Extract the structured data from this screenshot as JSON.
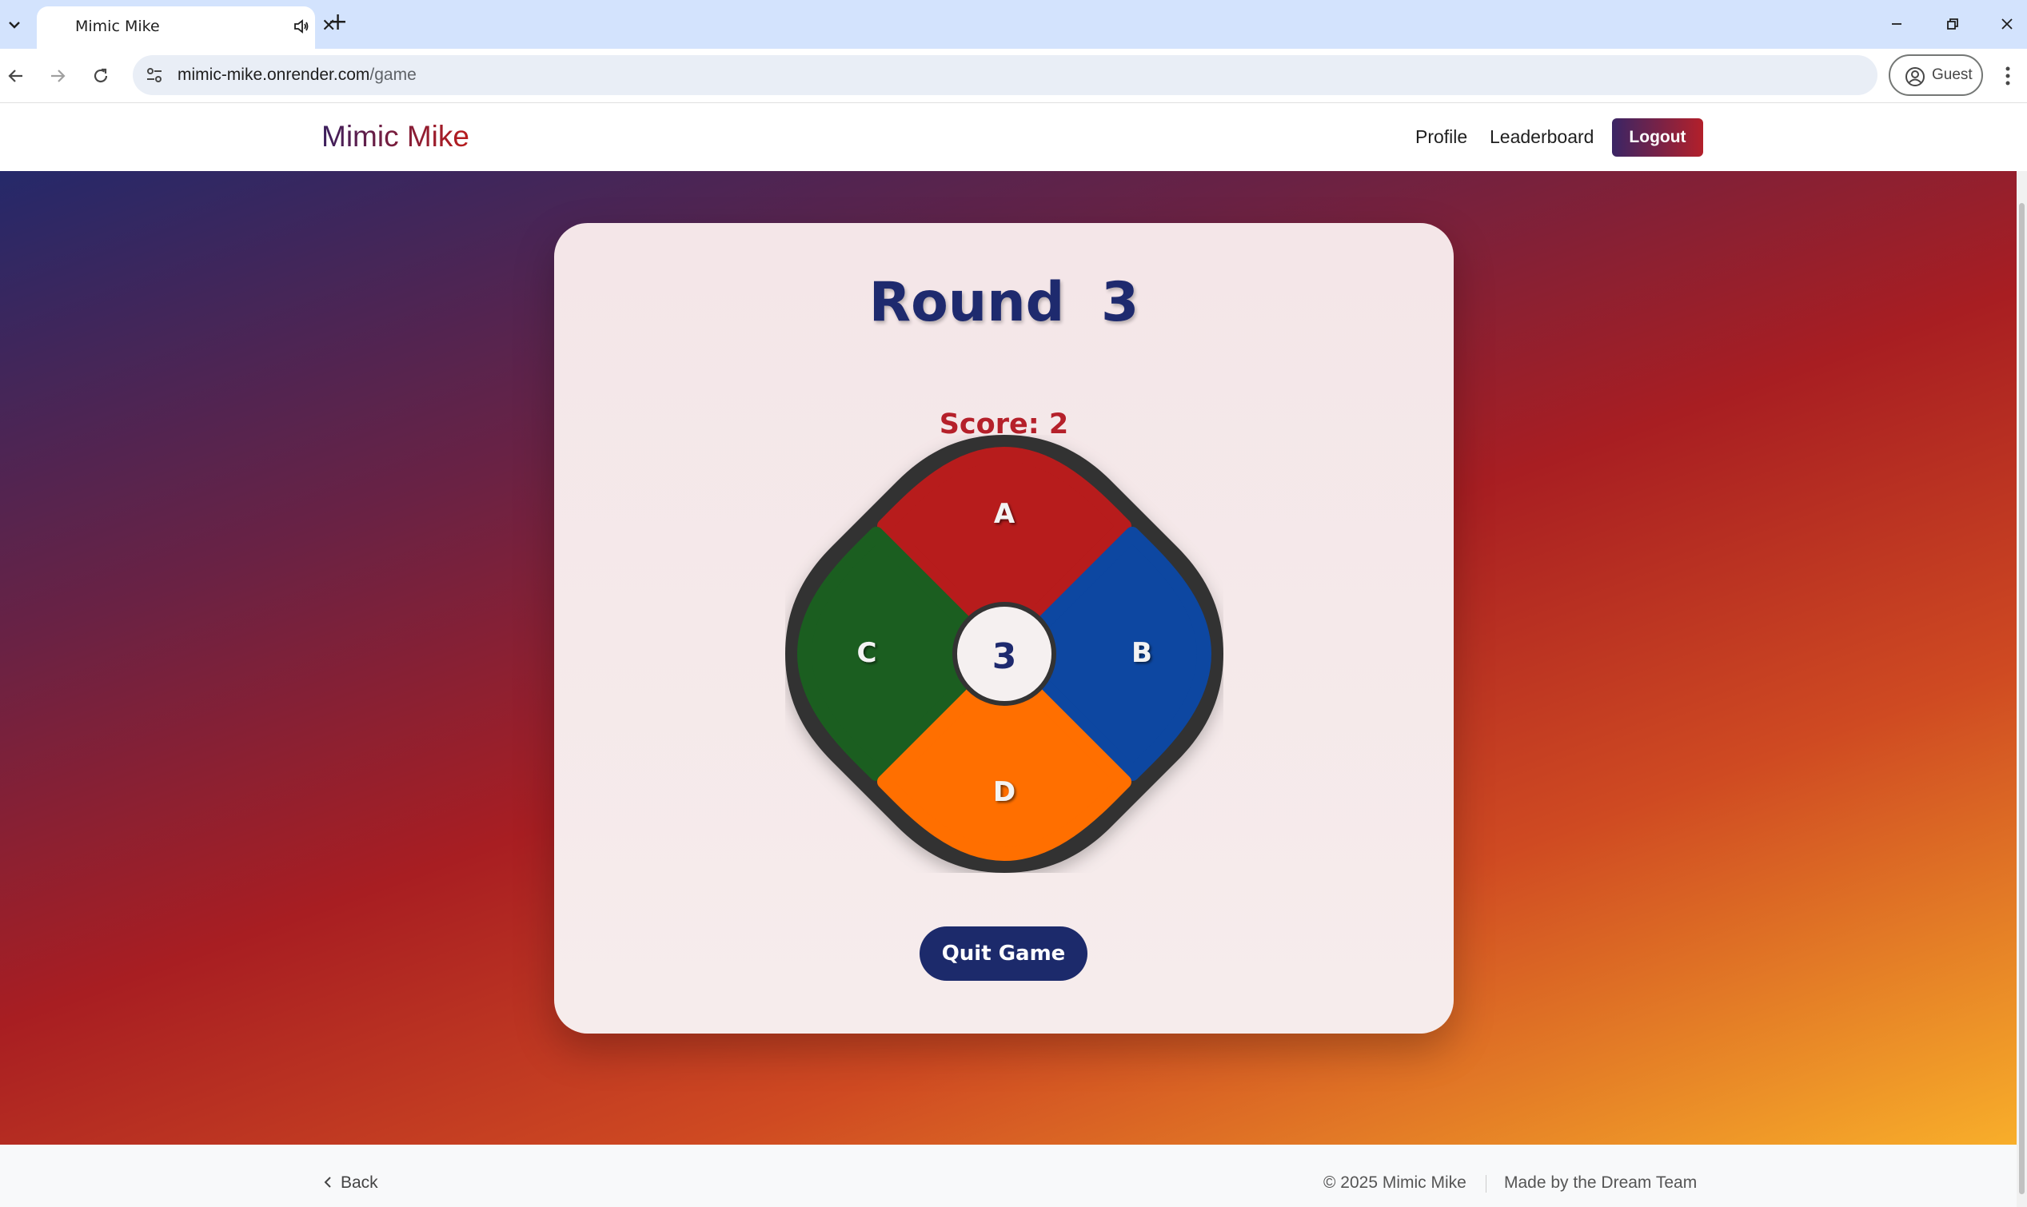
{
  "browser": {
    "tab_title": "Mimic Mike",
    "url_host": "mimic-mike.onrender.com",
    "url_path": "/game",
    "profile_label": "Guest"
  },
  "nav": {
    "brand": "Mimic Mike",
    "links": [
      "Profile",
      "Leaderboard"
    ],
    "logout": "Logout",
    "brand_gradient": [
      "#3b1f5e",
      "#b91c1c"
    ]
  },
  "game": {
    "round_label": "Round",
    "round_number": "3",
    "score_text": "Score: 2",
    "center_value": "3",
    "pads": [
      {
        "key": "A",
        "color": "#b71c1c"
      },
      {
        "key": "B",
        "color": "#0d47a1"
      },
      {
        "key": "C",
        "color": "#1b5e20"
      },
      {
        "key": "D",
        "color": "#ff6f00"
      }
    ],
    "quit_label": "Quit Game"
  },
  "footer": {
    "back": "Back",
    "copyright": "© 2025 Mimic Mike",
    "credit": "Made by the Dream Team"
  },
  "colors": {
    "title": "#1e2a6e",
    "score": "#b5202a",
    "quit_button": "#1c2a6b"
  }
}
